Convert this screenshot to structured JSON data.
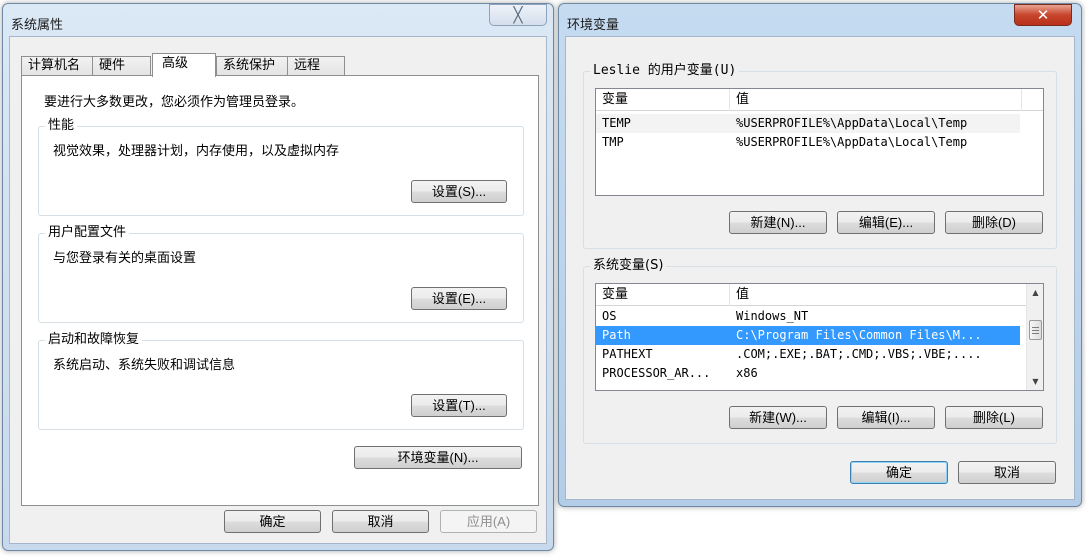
{
  "system_properties": {
    "title": "系统属性",
    "close_label": "╳",
    "tabs": [
      {
        "label": "计算机名"
      },
      {
        "label": "硬件"
      },
      {
        "label": "高级"
      },
      {
        "label": "系统保护"
      },
      {
        "label": "远程"
      }
    ],
    "admin_notice": "要进行大多数更改，您必须作为管理员登录。",
    "performance": {
      "title": "性能",
      "desc": "视觉效果，处理器计划，内存使用，以及虚拟内存",
      "button": "设置(S)..."
    },
    "user_profiles": {
      "title": "用户配置文件",
      "desc": "与您登录有关的桌面设置",
      "button": "设置(E)..."
    },
    "startup_recovery": {
      "title": "启动和故障恢复",
      "desc": "系统启动、系统失败和调试信息",
      "button": "设置(T)..."
    },
    "env_vars_button": "环境变量(N)...",
    "ok": "确定",
    "cancel": "取消",
    "apply": "应用(A)"
  },
  "environment_variables": {
    "title": "环境变量",
    "close_label": "✕",
    "user_vars": {
      "title": "Leslie 的用户变量(U)",
      "col_name": "变量",
      "col_value": "值",
      "rows": [
        {
          "name": "TEMP",
          "value": "%USERPROFILE%\\AppData\\Local\\Temp"
        },
        {
          "name": "TMP",
          "value": "%USERPROFILE%\\AppData\\Local\\Temp"
        }
      ],
      "new": "新建(N)...",
      "edit": "编辑(E)...",
      "delete": "删除(D)"
    },
    "system_vars": {
      "title": "系统变量(S)",
      "col_name": "变量",
      "col_value": "值",
      "rows": [
        {
          "name": "OS",
          "value": "Windows_NT"
        },
        {
          "name": "Path",
          "value": "C:\\Program Files\\Common Files\\M..."
        },
        {
          "name": "PATHEXT",
          "value": ".COM;.EXE;.BAT;.CMD;.VBS;.VBE;...."
        },
        {
          "name": "PROCESSOR_AR...",
          "value": "x86"
        }
      ],
      "selected_row": 1,
      "new": "新建(W)...",
      "edit": "编辑(I)...",
      "delete": "删除(L)"
    },
    "ok": "确定",
    "cancel": "取消"
  }
}
